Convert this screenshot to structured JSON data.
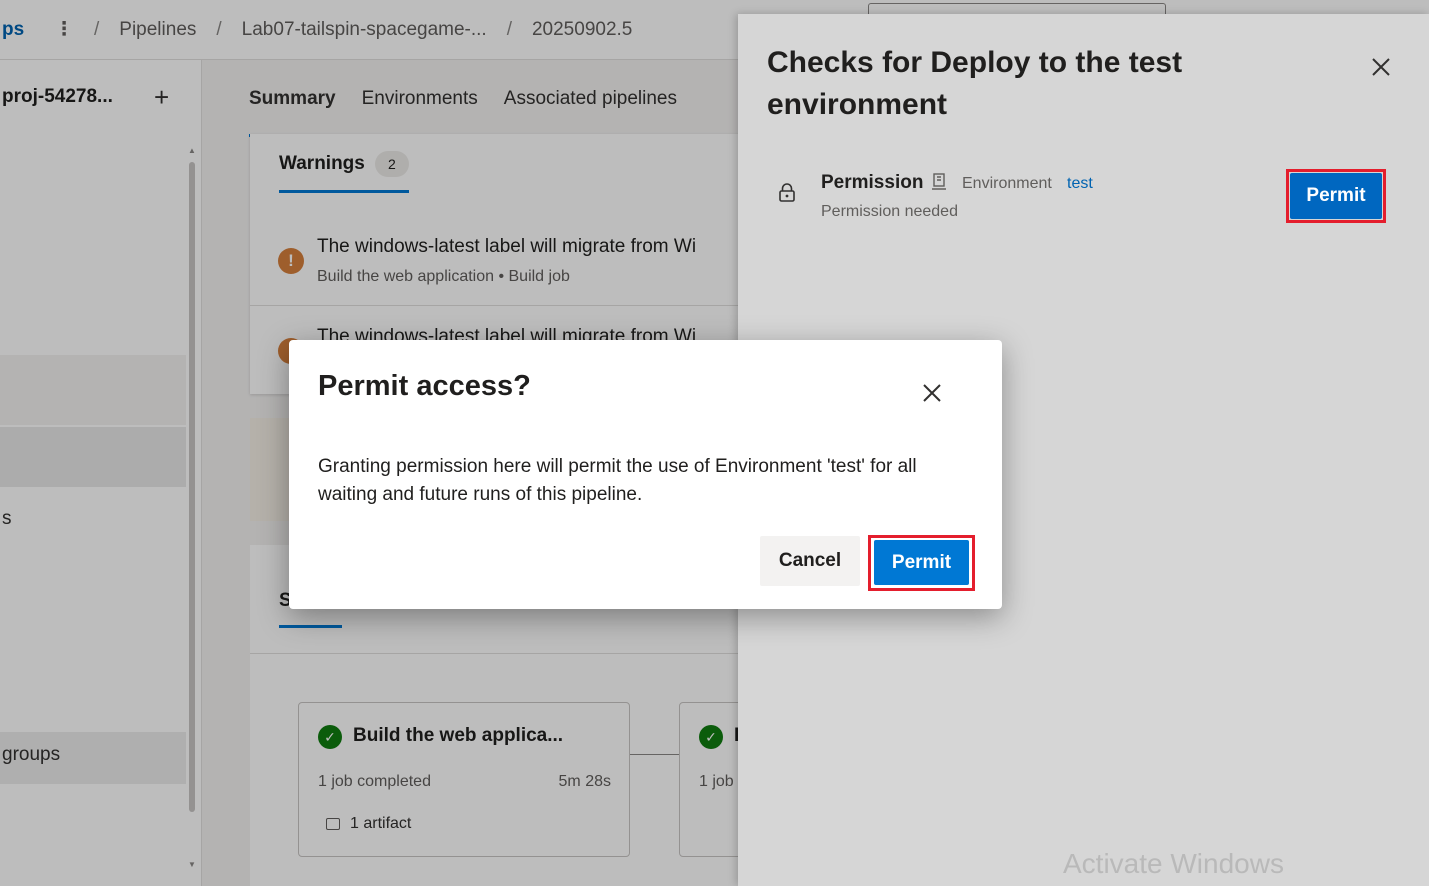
{
  "topbar": {
    "org_fragment": "ps",
    "more_glyph": "⋮",
    "separator": "/",
    "crumbs": [
      "Pipelines",
      "Lab07-tailspin-spacegame-...",
      "20250902.5"
    ]
  },
  "leftnav": {
    "project": "proj-54278...",
    "add_glyph": "+",
    "fragments": [
      "s",
      "groups"
    ]
  },
  "tabs": [
    "Summary",
    "Environments",
    "Associated pipelines"
  ],
  "warnings": {
    "label": "Warnings",
    "count": "2",
    "items": [
      {
        "title": "The windows-latest label will migrate from Wi",
        "subtitle": "Build the web application • Build job"
      },
      {
        "title": "The windows-latest label will migrate from Wi",
        "subtitle": ""
      }
    ]
  },
  "stages_card": {
    "label_fragment": "S"
  },
  "stages": [
    {
      "title": "Build the web applica...",
      "jobs": "1 job completed",
      "duration": "5m 28s",
      "artifacts": "1 artifact"
    },
    {
      "title": "I",
      "jobs": "1 job",
      "duration": "",
      "artifacts": ""
    }
  ],
  "panel": {
    "title": "Checks for Deploy to the test environment",
    "check": {
      "name": "Permission",
      "resource_type": "Environment",
      "resource_name": "test",
      "status": "Permission needed",
      "action_label": "Permit"
    },
    "watermark": "Activate Windows"
  },
  "dialog": {
    "title": "Permit access?",
    "body": "Granting permission here will permit the use of Environment 'test' for all waiting and future runs of this pipeline.",
    "cancel_label": "Cancel",
    "permit_label": "Permit"
  },
  "colors": {
    "accent": "#0078d4",
    "highlight": "#e41e2d",
    "success": "#107c10",
    "warning": "#d67f3c"
  }
}
